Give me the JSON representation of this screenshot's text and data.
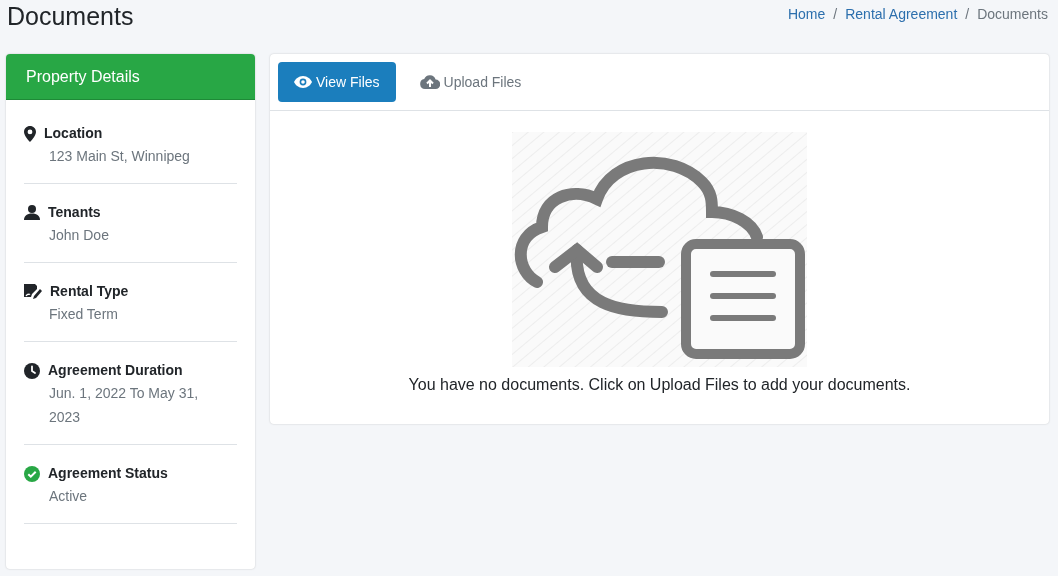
{
  "page_title": "Documents",
  "breadcrumb": {
    "items": [
      {
        "label": "Home",
        "current": false
      },
      {
        "label": "Rental Agreement",
        "current": false
      },
      {
        "label": "Documents",
        "current": true
      }
    ],
    "separators": [
      "/",
      "/"
    ]
  },
  "sidebar": {
    "title": "Property Details",
    "items": [
      {
        "kind": "location",
        "label": "Location",
        "value": "123 Main St, Winnipeg"
      },
      {
        "kind": "tenants",
        "label": "Tenants",
        "value": "John Doe"
      },
      {
        "kind": "rental_type",
        "label": "Rental Type",
        "value": "Fixed Term"
      },
      {
        "kind": "duration",
        "label": "Agreement Duration",
        "value": "Jun. 1, 2022 To May 31, 2023"
      },
      {
        "kind": "status",
        "label": "Agreement Status",
        "value": "Active"
      }
    ]
  },
  "tabs": [
    {
      "kind": "view",
      "label": "View Files",
      "selected": true
    },
    {
      "kind": "upload",
      "label": "Upload Files",
      "selected": false
    }
  ],
  "empty_message": "You have no documents. Click on Upload Files to add your documents."
}
